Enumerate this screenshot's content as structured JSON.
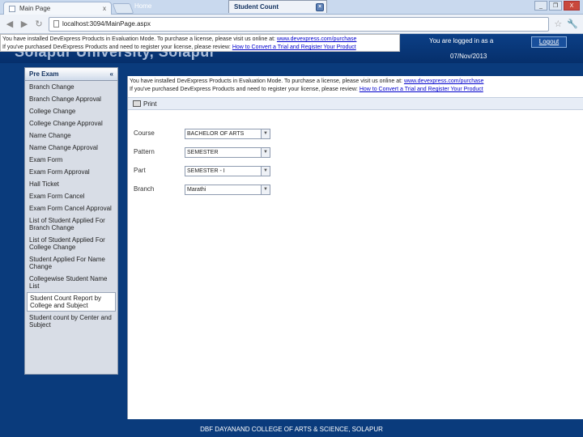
{
  "browser": {
    "tab_title": "Main Page",
    "tab_close": "x",
    "url": "localhost:3094/MainPage.aspx",
    "win_controls": [
      "_",
      "❐",
      "X"
    ]
  },
  "header": {
    "big_title": "Solapur University, Solapur",
    "eval_line1": "You have installed DevExpress Products in Evaluation Mode. To purchase a license, please visit us online at:",
    "eval_link1": "www.devexpress.com/purchase",
    "eval_line2": "If you've purchased DevExpress Products and need to register your license, please review:",
    "eval_link2": "How to Convert a Trial and Register Your Product",
    "logged_in": "You are logged in as a",
    "date": "07/Nov/2013",
    "logout": "Logout"
  },
  "sidebar": {
    "heading": "Pre Exam",
    "collapse_glyph": "«",
    "items": [
      "Branch Change",
      "Branch Change Approval",
      "College Change",
      "College Change Approval",
      "Name Change",
      "Name Change Approval",
      "Exam Form",
      "Exam Form Approval",
      "Hall Ticket",
      "Exam Form Cancel",
      "Exam Form Cancel Approval",
      "List of Student Applied For Branch Change",
      "List of Student Applied For College Change",
      "Student Applied For Name Change",
      "Collegewise Student Name List",
      "Student Count Report by College and Subject",
      "Student count by Center and Subject"
    ],
    "selected_index": 15
  },
  "tabs": {
    "home": "Home",
    "active": "Student Count"
  },
  "panel": {
    "eval_line1": "You have installed DevExpress Products in Evaluation Mode. To purchase a license, please visit us online at:",
    "eval_link1": "www.devexpress.com/purchase",
    "eval_line2": "If you've purchased DevExpress Products and need to register your license, please review:",
    "eval_link2": "How to Convert a Trial and Register Your Product",
    "print_label": "Print",
    "fields": [
      {
        "label": "Course",
        "value": "BACHELOR OF ARTS"
      },
      {
        "label": "Pattern",
        "value": "SEMESTER"
      },
      {
        "label": "Part",
        "value": "SEMESTER - I"
      },
      {
        "label": "Branch",
        "value": "Marathi"
      }
    ]
  },
  "footer": {
    "text": "DBF DAYANAND COLLEGE OF ARTS & SCIENCE, SOLAPUR"
  },
  "colors": {
    "header_blue": "#0a3b7c",
    "link": "#0000cc"
  }
}
